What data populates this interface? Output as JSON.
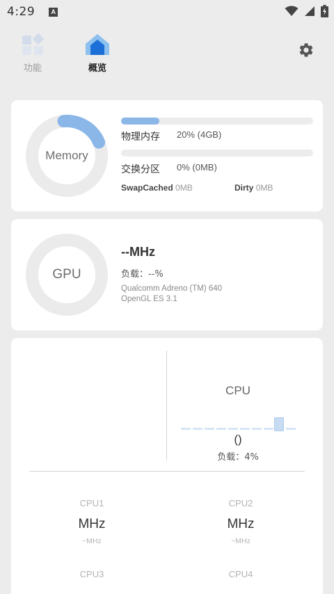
{
  "status_bar": {
    "time": "4:29",
    "notification_icon": "A"
  },
  "nav": {
    "tabs": [
      {
        "label": "功能",
        "icon": "grid-icon",
        "active": false
      },
      {
        "label": "概览",
        "icon": "home-icon",
        "active": true
      }
    ],
    "settings_icon": "gear-icon"
  },
  "memory": {
    "ring_label": "Memory",
    "ring_fraction": 0.2,
    "physical_label": "物理内存",
    "physical_value": "20% (4GB)",
    "physical_fraction": 0.2,
    "swap_label": "交换分区",
    "swap_value": "0% (0MB)",
    "swap_fraction": 0,
    "swapcached_label": "SwapCached",
    "swapcached_value": "0MB",
    "dirty_label": "Dirty",
    "dirty_value": "0MB"
  },
  "gpu": {
    "ring_label": "GPU",
    "freq": "--MHz",
    "load": "负载：--%",
    "model": "Qualcomm Adreno (TM) 640",
    "opengl": "OpenGL ES 3.1"
  },
  "cpu": {
    "title": "CPU",
    "freq": "()",
    "load": "负载：4%",
    "load_fraction": 0.04,
    "cores": [
      {
        "name": "CPU1",
        "freq": "MHz",
        "sub": "~MHz"
      },
      {
        "name": "CPU2",
        "freq": "MHz",
        "sub": "~MHz"
      },
      {
        "name": "CPU3"
      },
      {
        "name": "CPU4"
      }
    ]
  },
  "colors": {
    "accent": "#8ab6e8",
    "ring_track": "#ebebeb",
    "background": "#ececec"
  }
}
